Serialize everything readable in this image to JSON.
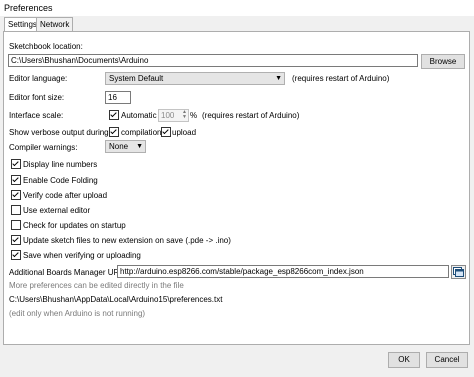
{
  "window": {
    "title": "Preferences"
  },
  "tabs": [
    {
      "label": "Settings"
    },
    {
      "label": "Network"
    }
  ],
  "sketchbook": {
    "label": "Sketchbook location:",
    "path": "C:\\Users\\Bhushan\\Documents\\Arduino",
    "browse_label": "Browse"
  },
  "editor_language": {
    "label": "Editor language:",
    "value": "System Default",
    "note": "(requires restart of Arduino)"
  },
  "editor_font_size": {
    "label": "Editor font size:",
    "value": "16"
  },
  "interface_scale": {
    "label": "Interface scale:",
    "auto_label": "Automatic",
    "auto_checked": true,
    "value": "100",
    "unit": "%",
    "note": "(requires restart of Arduino)"
  },
  "verbose": {
    "label": "Show verbose output during:",
    "compilation_label": "compilation",
    "compilation_checked": true,
    "upload_label": "upload",
    "upload_checked": true
  },
  "compiler_warnings": {
    "label": "Compiler warnings:",
    "value": "None"
  },
  "options": [
    {
      "label": "Display line numbers",
      "checked": true
    },
    {
      "label": "Enable Code Folding",
      "checked": true
    },
    {
      "label": "Verify code after upload",
      "checked": true
    },
    {
      "label": "Use external editor",
      "checked": false
    },
    {
      "label": "Check for updates on startup",
      "checked": false
    },
    {
      "label": "Update sketch files to new extension on save (.pde -> .ino)",
      "checked": true
    },
    {
      "label": "Save when verifying or uploading",
      "checked": true
    }
  ],
  "boards_manager": {
    "label": "Additional Boards Manager URLs:",
    "value": "http://arduino.esp8266.com/stable/package_esp8266com_index.json"
  },
  "info": {
    "more_prefs": "More preferences can be edited directly in the file",
    "prefs_path": "C:\\Users\\Bhushan\\AppData\\Local\\Arduino15\\preferences.txt",
    "edit_note": "(edit only when Arduino is not running)"
  },
  "buttons": {
    "ok": "OK",
    "cancel": "Cancel"
  }
}
